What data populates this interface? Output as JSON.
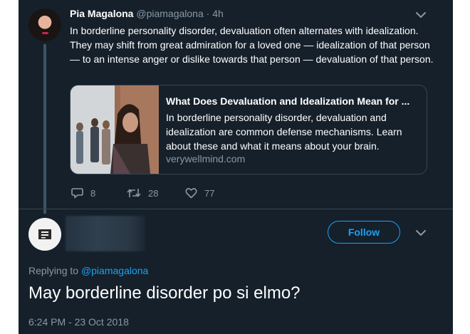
{
  "tweet": {
    "author_name": "Pia Magalona",
    "author_handle": "@piamagalona",
    "separator": " · ",
    "time": "4h",
    "text": "In borderline personality disorder, devaluation often alternates with idealization. They may shift from great admiration for a loved one — idealization of that person — to an intense anger or dislike towards that person — devaluation of that person.",
    "card": {
      "title": "What Does Devaluation and Idealization Mean for ...",
      "description": "In borderline personality disorder, devaluation and idealization are common defense mechanisms. Learn about these and what it means about your brain.",
      "domain": "verywellmind.com"
    },
    "actions": {
      "replies": "8",
      "retweets": "28",
      "likes": "77"
    }
  },
  "reply": {
    "follow_label": "Follow",
    "replying_prefix": "Replying to ",
    "replying_handle": "@piamagalona",
    "text": "May borderline disorder po si elmo?",
    "timestamp": "6:24 PM - 23 Oct 2018"
  },
  "colors": {
    "background": "#15202b",
    "accent": "#1da1f2",
    "secondary_text": "#8899a6",
    "border": "#38444d"
  },
  "icons": [
    "chevron-down-icon",
    "reply-icon",
    "retweet-icon",
    "like-icon",
    "profile-picture"
  ]
}
